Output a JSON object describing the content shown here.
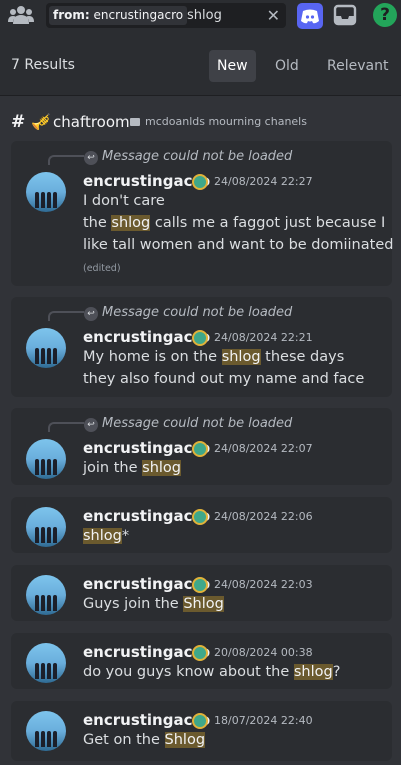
{
  "search": {
    "filter_key": "from:",
    "filter_value": "encrustingacro",
    "query": "shlog",
    "clear_glyph": "✕"
  },
  "toolbar": {
    "help_glyph": "?"
  },
  "results_header": {
    "count_label": "7 Results",
    "sort_tabs": [
      "New",
      "Old",
      "Relevant"
    ],
    "active_sort": "New"
  },
  "channel": {
    "hash_glyph": "#",
    "emoji": "🎺",
    "name": "chaftroom",
    "category": "mcdoanlds mourning chanels"
  },
  "reply_placeholder": "Message could not be loaded",
  "messages": [
    {
      "author": "encrustingacro",
      "timestamp": "24/08/2024 22:27",
      "line1": "I don't care",
      "line2_pre": "the ",
      "line2_hl": "shlog",
      "line2_post": " calls me a faggot just because I",
      "line3": "like tall women and want to be domiinated",
      "edited": "(edited)"
    },
    {
      "author": "encrustingacro",
      "timestamp": "24/08/2024 22:21",
      "line1_pre": "My home is on the ",
      "line1_hl": "shlog",
      "line1_post": " these days",
      "line2": "they also found out my name and face"
    },
    {
      "author": "encrustingacro",
      "timestamp": "24/08/2024 22:07",
      "pre": "join the ",
      "hl": "shlog",
      "post": ""
    },
    {
      "author": "encrustingacro",
      "timestamp": "24/08/2024 22:06",
      "pre": "",
      "hl": "shlog",
      "post": "*"
    },
    {
      "author": "encrustingacro",
      "timestamp": "24/08/2024 22:03",
      "pre": "Guys join the ",
      "hl": "Shlog",
      "post": ""
    },
    {
      "author": "encrustingacro",
      "timestamp": "20/08/2024 00:38",
      "pre": "do you guys know about the ",
      "hl": "shlog",
      "post": "?"
    },
    {
      "author": "encrustingacro",
      "timestamp": "18/07/2024 22:40",
      "pre": "Get on the ",
      "hl": "Shlog",
      "post": ""
    }
  ],
  "colors": {
    "background": "#313338",
    "card": "#2b2d31",
    "highlight": "#6b5a2e",
    "help_green": "#23a55a",
    "blurple": "#5865f2"
  }
}
